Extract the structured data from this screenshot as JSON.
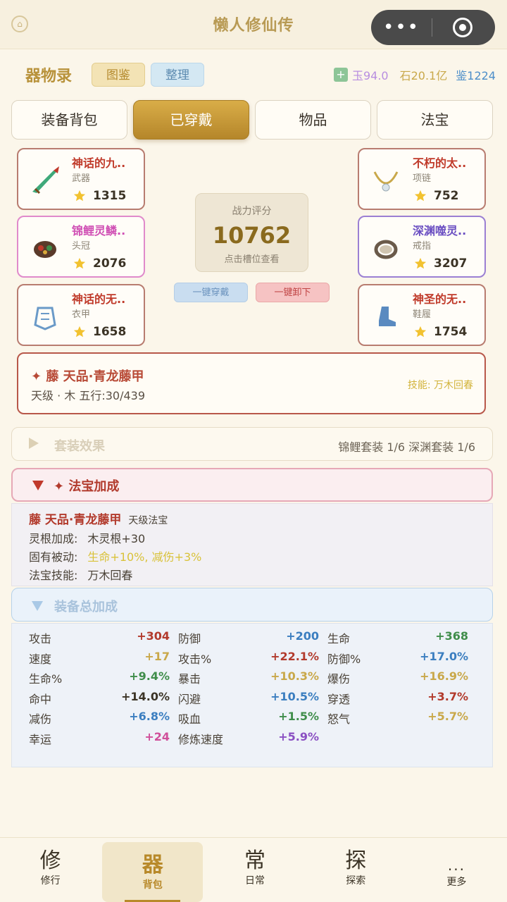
{
  "app": {
    "title": "懒人修仙传"
  },
  "header": {
    "title": "器物录",
    "btn_gallery": "图鉴",
    "btn_sort": "整理",
    "resources": {
      "jade": "玉94.0",
      "stone": "石20.1亿",
      "coin": "鉴1224"
    }
  },
  "tabs": [
    "装备背包",
    "已穿戴",
    "物品",
    "法宝"
  ],
  "slots": {
    "weapon": {
      "name": "神话的九..",
      "type": "武器",
      "power": "1315"
    },
    "helmet": {
      "name": "锦鲤灵鳞..",
      "type": "头冠",
      "power": "2076"
    },
    "armor": {
      "name": "神话的无..",
      "type": "衣甲",
      "power": "1658"
    },
    "necklace": {
      "name": "不朽的太..",
      "type": "项链",
      "power": "752"
    },
    "ring": {
      "name": "深渊噬灵..",
      "type": "戒指",
      "power": "3207"
    },
    "boots": {
      "name": "神圣的无..",
      "type": "鞋履",
      "power": "1754"
    }
  },
  "score": {
    "label": "战力评分",
    "value": "10762",
    "hint": "点击槽位查看"
  },
  "actions": {
    "equip_all": "一键穿戴",
    "unequip_all": "一键卸下"
  },
  "treasure": {
    "title": "✦ 藤 天品·青龙藤甲",
    "sub": "天级 · 木  五行:30/439",
    "skill": "技能: 万木回春"
  },
  "set_effect": {
    "label": "套装效果",
    "value": "锦鲤套装 1/6 深渊套装 1/6"
  },
  "fabao_bonus": {
    "label": "✦ 法宝加成",
    "name": "藤 天品·青龙藤甲",
    "grade": "天级法宝",
    "root_key": "灵根加成:",
    "root_val": "木灵根+30",
    "passive_key": "固有被动:",
    "passive_val": "生命+10%, 减伤+3%",
    "skill_key": "法宝技能:",
    "skill_val": "万木回春"
  },
  "total_bonus": {
    "label": "装备总加成"
  },
  "stats": [
    {
      "k": "攻击",
      "v": "+304",
      "c": "#b23a2c"
    },
    {
      "k": "防御",
      "v": "+200",
      "c": "#3b7ec0"
    },
    {
      "k": "生命",
      "v": "+368",
      "c": "#3f8d4a"
    },
    {
      "k": "速度",
      "v": "+17",
      "c": "#c9a84a"
    },
    {
      "k": "攻击%",
      "v": "+22.1%",
      "c": "#b23a2c"
    },
    {
      "k": "防御%",
      "v": "+17.0%",
      "c": "#3b7ec0"
    },
    {
      "k": "生命%",
      "v": "+9.4%",
      "c": "#3f8d4a"
    },
    {
      "k": "暴击",
      "v": "+10.3%",
      "c": "#c9a84a"
    },
    {
      "k": "爆伤",
      "v": "+16.9%",
      "c": "#c9a84a"
    },
    {
      "k": "命中",
      "v": "+14.0%",
      "c": "#3b3325"
    },
    {
      "k": "闪避",
      "v": "+10.5%",
      "c": "#3b7ec0"
    },
    {
      "k": "穿透",
      "v": "+3.7%",
      "c": "#b23a2c"
    },
    {
      "k": "减伤",
      "v": "+6.8%",
      "c": "#3b7ec0"
    },
    {
      "k": "吸血",
      "v": "+1.5%",
      "c": "#3f8d4a"
    },
    {
      "k": "怒气",
      "v": "+5.7%",
      "c": "#c9a84a"
    },
    {
      "k": "幸运",
      "v": "+24",
      "c": "#d04f9a"
    },
    {
      "k": "修炼速度",
      "v": "+5.9%",
      "c": "#8a4fc2"
    }
  ],
  "nav": [
    {
      "big": "修",
      "sm": "修行"
    },
    {
      "big": "器",
      "sm": "背包"
    },
    {
      "big": "常",
      "sm": "日常"
    },
    {
      "big": "探",
      "sm": "探索"
    },
    {
      "big": "...",
      "sm": "更多"
    }
  ]
}
